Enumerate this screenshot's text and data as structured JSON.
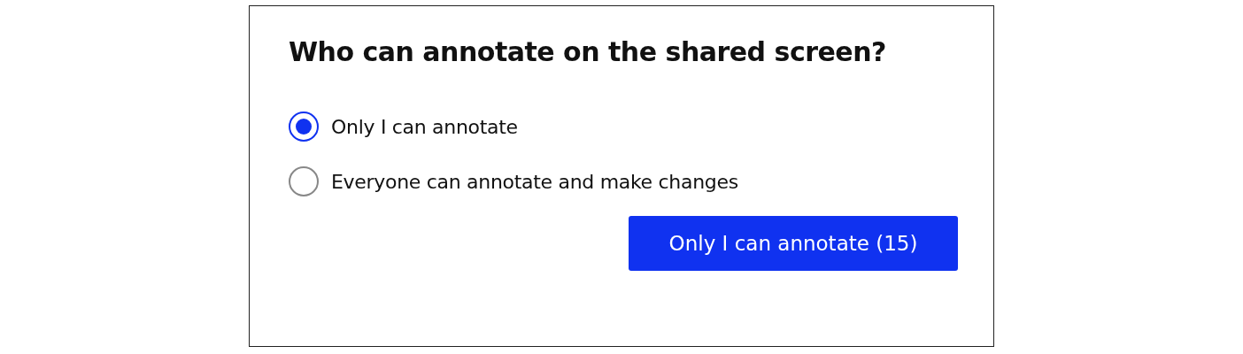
{
  "dialog": {
    "title": "Who can annotate on the shared screen?",
    "options": [
      {
        "label": "Only I can annotate",
        "selected": true
      },
      {
        "label": "Everyone can annotate and make changes",
        "selected": false
      }
    ],
    "button": "Only I can annotate (15)"
  }
}
